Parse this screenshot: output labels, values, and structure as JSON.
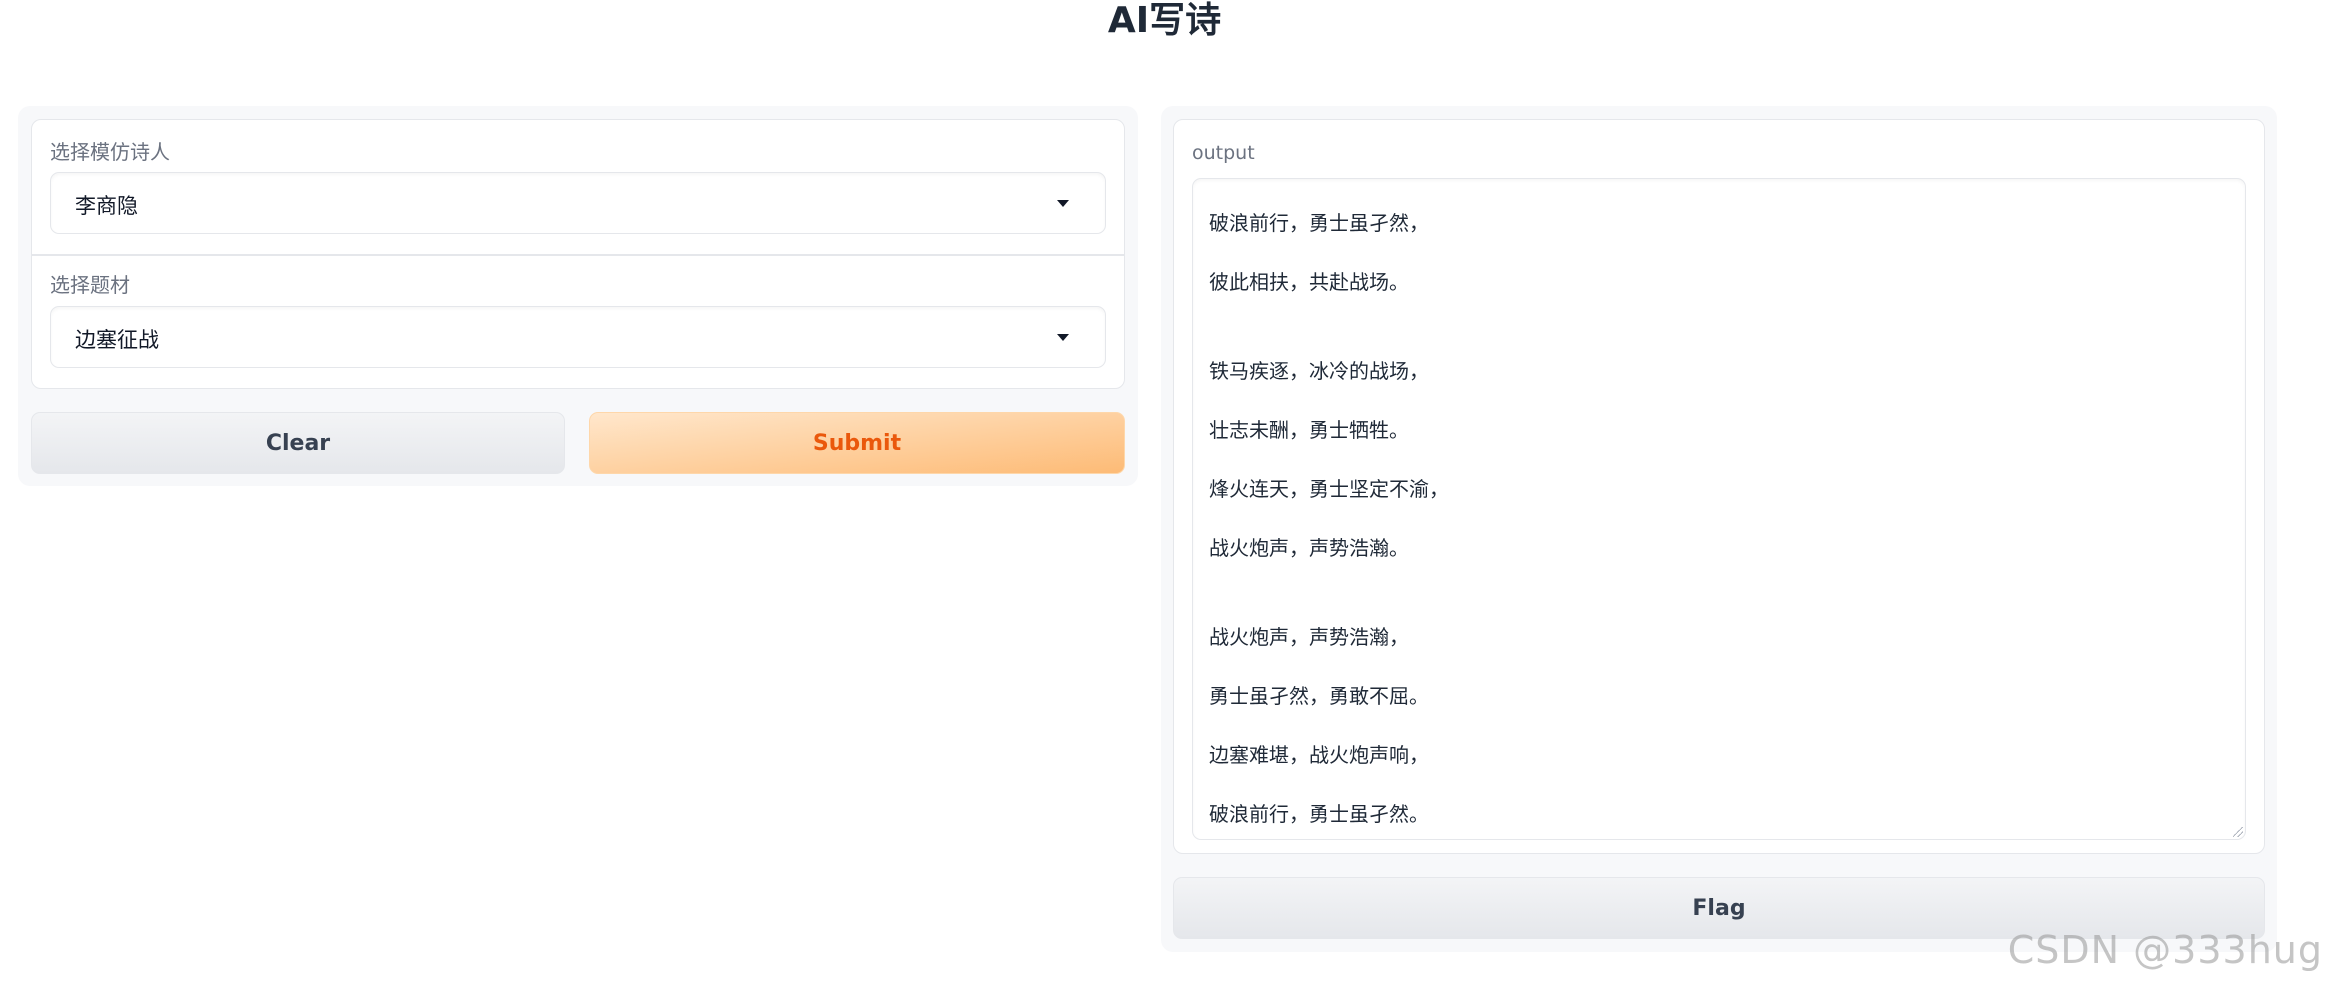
{
  "header": {
    "title": "AI写诗"
  },
  "inputs": {
    "poet": {
      "label": "选择模仿诗人",
      "value": "李商隐"
    },
    "theme": {
      "label": "选择题材",
      "value": "边塞征战"
    }
  },
  "actions": {
    "clear_label": "Clear",
    "submit_label": "Submit",
    "flag_label": "Flag"
  },
  "output": {
    "label": "output",
    "lines": [
      "破浪前行，勇士虽孑然，",
      "彼此相扶，共赴战场。",
      "",
      "铁马疾逐，冰冷的战场，",
      "壮志未酬，勇士牺牲。",
      "烽火连天，勇士坚定不渝，",
      "战火炮声，声势浩瀚。",
      "",
      "战火炮声，声势浩瀚，",
      "勇士虽孑然，勇敢不屈。",
      "边塞难堪，战火炮声响，",
      "破浪前行，勇士虽孑然。"
    ]
  },
  "watermark": "CSDN @333hug"
}
